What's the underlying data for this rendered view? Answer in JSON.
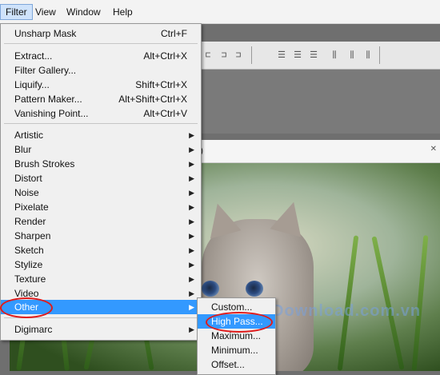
{
  "menubar": {
    "items": [
      {
        "label": "Filter"
      },
      {
        "label": "View"
      },
      {
        "label": "Window"
      },
      {
        "label": "Help"
      }
    ]
  },
  "filter_menu": {
    "unsharp_mask": {
      "label": "Unsharp Mask",
      "shortcut": "Ctrl+F"
    },
    "extract": {
      "label": "Extract...",
      "shortcut": "Alt+Ctrl+X"
    },
    "filter_gallery": {
      "label": "Filter Gallery..."
    },
    "liquify": {
      "label": "Liquify...",
      "shortcut": "Shift+Ctrl+X"
    },
    "pattern_maker": {
      "label": "Pattern Maker...",
      "shortcut": "Alt+Shift+Ctrl+X"
    },
    "vanishing_point": {
      "label": "Vanishing Point...",
      "shortcut": "Alt+Ctrl+V"
    },
    "categories": [
      {
        "label": "Artistic"
      },
      {
        "label": "Blur"
      },
      {
        "label": "Brush Strokes"
      },
      {
        "label": "Distort"
      },
      {
        "label": "Noise"
      },
      {
        "label": "Pixelate"
      },
      {
        "label": "Render"
      },
      {
        "label": "Sharpen"
      },
      {
        "label": "Sketch"
      },
      {
        "label": "Stylize"
      },
      {
        "label": "Texture"
      },
      {
        "label": "Video"
      },
      {
        "label": "Other"
      }
    ],
    "digimarc": {
      "label": "Digimarc"
    }
  },
  "other_submenu": {
    "items": [
      {
        "label": "Custom..."
      },
      {
        "label": "High Pass..."
      },
      {
        "label": "Maximum..."
      },
      {
        "label": "Minimum..."
      },
      {
        "label": "Offset..."
      }
    ]
  },
  "document": {
    "tab_fragment": ")"
  },
  "watermark": "Download.com.vn",
  "colors": {
    "highlight": "#3399ff",
    "annotation_ring": "#e01b1b"
  }
}
